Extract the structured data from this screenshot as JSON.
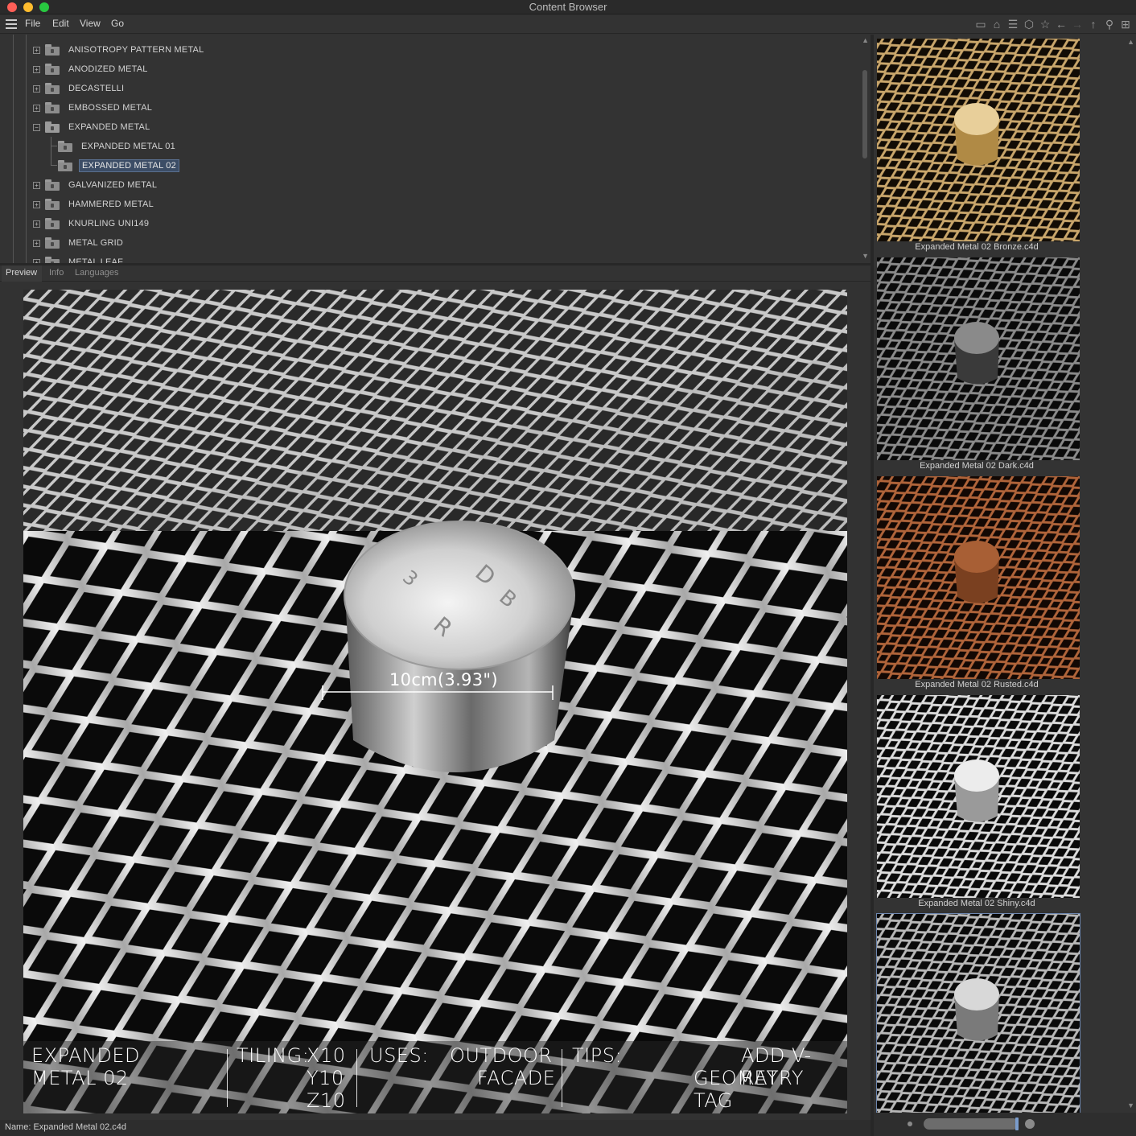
{
  "window": {
    "title": "Content Browser"
  },
  "menu": {
    "file": "File",
    "edit": "Edit",
    "view": "View",
    "go": "Go"
  },
  "toolbar": {
    "icons": [
      "monitor-icon",
      "home-icon",
      "sliders-icon",
      "box-icon",
      "star-icon",
      "back-icon",
      "forward-icon",
      "up-icon",
      "search-icon",
      "add-icon"
    ]
  },
  "tree": {
    "items": [
      {
        "label": "ANISOTROPY PATTERN METAL",
        "level": 1,
        "expanded": false
      },
      {
        "label": "ANODIZED METAL",
        "level": 1,
        "expanded": false
      },
      {
        "label": "DECASTELLI",
        "level": 1,
        "expanded": false
      },
      {
        "label": "EMBOSSED METAL",
        "level": 1,
        "expanded": false
      },
      {
        "label": "EXPANDED METAL",
        "level": 1,
        "expanded": true
      },
      {
        "label": "EXPANDED METAL 01",
        "level": 2
      },
      {
        "label": "EXPANDED METAL 02",
        "level": 2,
        "selected": true
      },
      {
        "label": "GALVANIZED METAL",
        "level": 1,
        "expanded": false
      },
      {
        "label": "HAMMERED METAL",
        "level": 1,
        "expanded": false
      },
      {
        "label": "KNURLING UNI149",
        "level": 1,
        "expanded": false
      },
      {
        "label": "METAL GRID",
        "level": 1,
        "expanded": false
      },
      {
        "label": "METAL LEAF",
        "level": 1,
        "expanded": false
      }
    ]
  },
  "tabs": {
    "preview": "Preview",
    "info": "Info",
    "languages": "Languages"
  },
  "preview": {
    "dimension": "10cm(3.93\")",
    "caption": {
      "name_line1": "EXPANDED",
      "name_line2": "METAL 02",
      "tiling_label": "TILING:",
      "tiling_x": "X10",
      "tiling_y": "Y10",
      "tiling_z": "Z10",
      "uses_label": "USES:",
      "uses_line1": "OUTDOOR",
      "uses_line2": "FACADE",
      "tips_label": "TIPS:",
      "tips_line1": "ADD V-RAY",
      "tips_line2": "GEOMETRY TAG"
    }
  },
  "status": {
    "name": "Name:  Expanded Metal 02.c4d"
  },
  "thumbnails": [
    {
      "label": "Expanded Metal 02 Bronze.c4d",
      "color": "#c9a66b"
    },
    {
      "label": "Expanded Metal 02 Dark.c4d",
      "color": "#8a8a8a"
    },
    {
      "label": "Expanded Metal 02 Rusted.c4d",
      "color": "#b0643a"
    },
    {
      "label": "Expanded Metal 02 Shiny.c4d",
      "color": "#c8c8c8"
    },
    {
      "label": "",
      "color": "#b8b8b8"
    }
  ]
}
